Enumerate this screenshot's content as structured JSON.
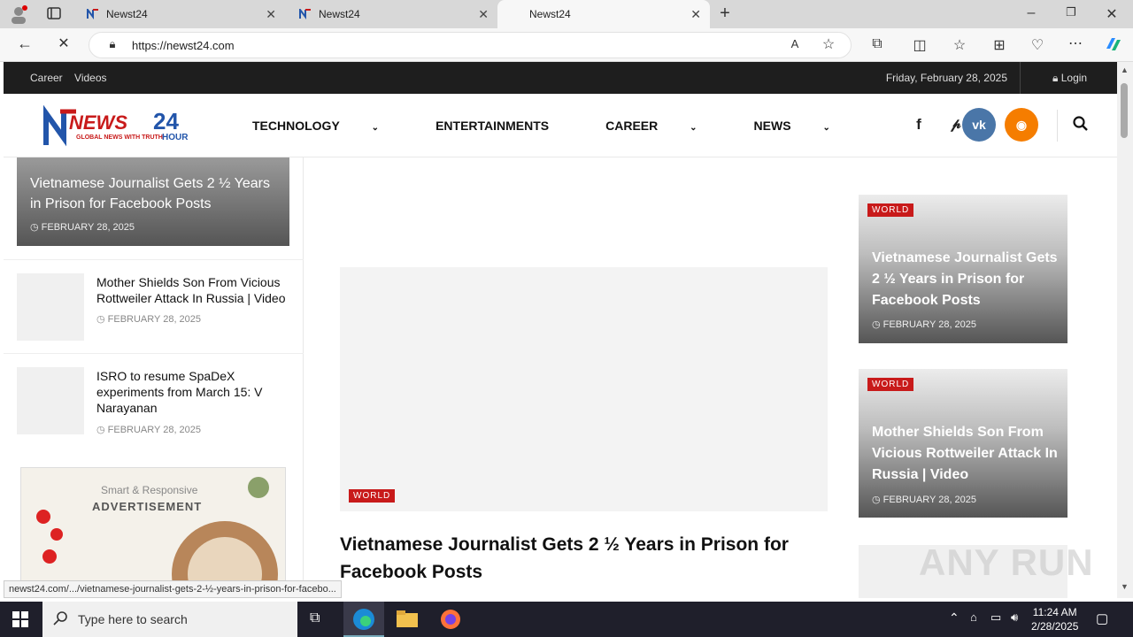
{
  "browser": {
    "tabs": [
      {
        "title": "Newst24"
      },
      {
        "title": "Newst24"
      },
      {
        "title": "Newst24"
      }
    ],
    "url": "https://newst24.com",
    "status_url": "newst24.com/.../vietnamese-journalist-gets-2-½-years-in-prison-for-facebo..."
  },
  "site": {
    "topbar": {
      "links": [
        "Career",
        "Videos"
      ],
      "date": "Friday, February 28, 2025",
      "login": "Login"
    },
    "logo": {
      "word": "NEWS",
      "number": "24",
      "tagline": "GLOBAL NEWS WITH TRUTH",
      "sub": "HOUR"
    },
    "menu": [
      "TECHNOLOGY",
      "ENTERTAINMENTS",
      "CAREER",
      "NEWS"
    ],
    "colors": {
      "accent": "#c81a1a",
      "vk": "#4a76a8",
      "rss": "#f57d00"
    }
  },
  "left": {
    "hero": {
      "title": "Vietnamese Journalist Gets 2 ½ Years in Prison for Facebook Posts",
      "date": "FEBRUARY 28, 2025"
    },
    "items": [
      {
        "title": "Mother Shields Son From Vicious Rottweiler Attack In Russia | Video",
        "date": "FEBRUARY 28, 2025"
      },
      {
        "title": "ISRO to resume SpaDeX experiments from March 15: V Narayanan",
        "date": "FEBRUARY 28, 2025"
      }
    ],
    "ad": {
      "line1": "Smart & Responsive",
      "line2": "ADVERTISEMENT"
    }
  },
  "center": {
    "category": "WORLD",
    "title": "Vietnamese Journalist Gets 2 ½ Years in Prison for Facebook Posts"
  },
  "right": {
    "cards": [
      {
        "category": "WORLD",
        "title": "Vietnamese Journalist Gets 2 ½ Years in Prison for Facebook Posts",
        "date": "FEBRUARY 28, 2025"
      },
      {
        "category": "WORLD",
        "title": "Mother Shields Son From Vicious Rottweiler Attack In Russia | Video",
        "date": "FEBRUARY 28, 2025"
      }
    ]
  },
  "watermark": "ANY RUN",
  "taskbar": {
    "search_placeholder": "Type here to search",
    "time": "11:24 AM",
    "date": "2/28/2025"
  }
}
